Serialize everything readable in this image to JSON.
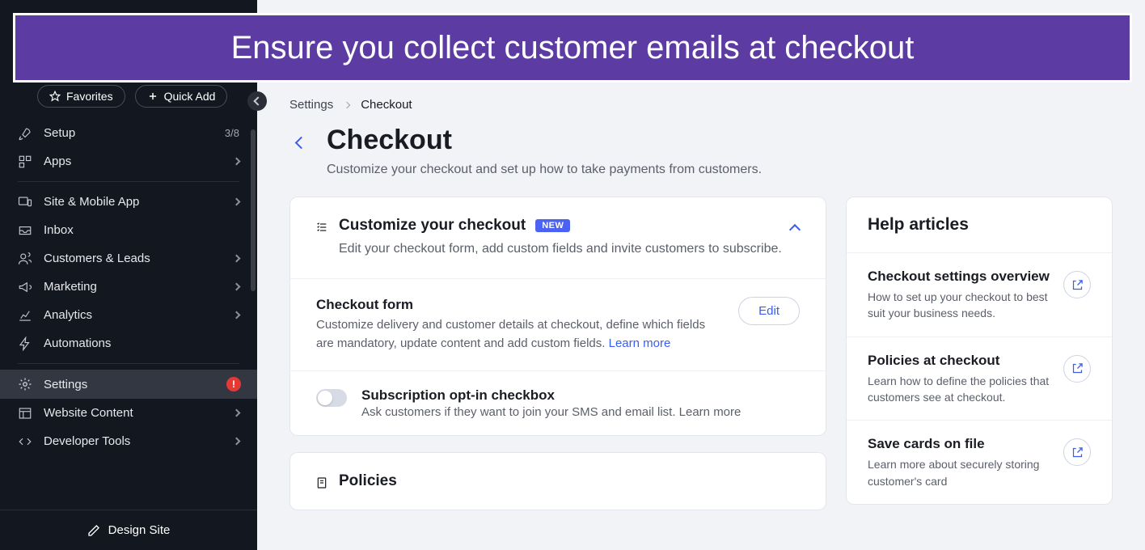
{
  "banner": {
    "text": "Ensure you collect customer emails at checkout"
  },
  "sidebar": {
    "favorites_label": "Favorites",
    "quickadd_label": "Quick Add",
    "items": [
      {
        "name": "setup",
        "label": "Setup",
        "aux": "3/8",
        "expandable": false
      },
      {
        "name": "apps",
        "label": "Apps",
        "aux": "",
        "expandable": true
      },
      {
        "divider": true
      },
      {
        "name": "site-mobile",
        "label": "Site & Mobile App",
        "expandable": true
      },
      {
        "name": "inbox",
        "label": "Inbox",
        "expandable": false
      },
      {
        "name": "customers",
        "label": "Customers & Leads",
        "expandable": true
      },
      {
        "name": "marketing",
        "label": "Marketing",
        "expandable": true
      },
      {
        "name": "analytics",
        "label": "Analytics",
        "expandable": true
      },
      {
        "name": "automations",
        "label": "Automations",
        "expandable": false
      },
      {
        "divider": true
      },
      {
        "name": "settings",
        "label": "Settings",
        "active": true,
        "alert": true
      },
      {
        "name": "website-content",
        "label": "Website Content",
        "expandable": true
      },
      {
        "name": "developer-tools",
        "label": "Developer Tools",
        "expandable": true
      }
    ],
    "design_site_label": "Design Site"
  },
  "breadcrumb": {
    "root": "Settings",
    "current": "Checkout"
  },
  "page": {
    "title": "Checkout",
    "subtitle": "Customize your checkout and set up how to take payments from customers."
  },
  "customize_section": {
    "title": "Customize your checkout",
    "badge": "NEW",
    "desc": "Edit your checkout form, add custom fields and invite customers to subscribe."
  },
  "checkout_form": {
    "title": "Checkout form",
    "desc": "Customize delivery and customer details at checkout, define which fields are mandatory, update content and add custom fields.",
    "learn_more": "Learn more",
    "edit": "Edit"
  },
  "subscription": {
    "title": "Subscription opt-in checkbox",
    "desc": "Ask customers if they want to join your SMS and email list.",
    "learn_more": "Learn more"
  },
  "policies": {
    "title": "Policies"
  },
  "help": {
    "title": "Help articles",
    "items": [
      {
        "title": "Checkout settings overview",
        "desc": "How to set up your checkout to best suit your business needs."
      },
      {
        "title": "Policies at checkout",
        "desc": "Learn how to define the policies that customers see at checkout."
      },
      {
        "title": "Save cards on file",
        "desc": "Learn more about securely storing customer's card"
      }
    ]
  }
}
